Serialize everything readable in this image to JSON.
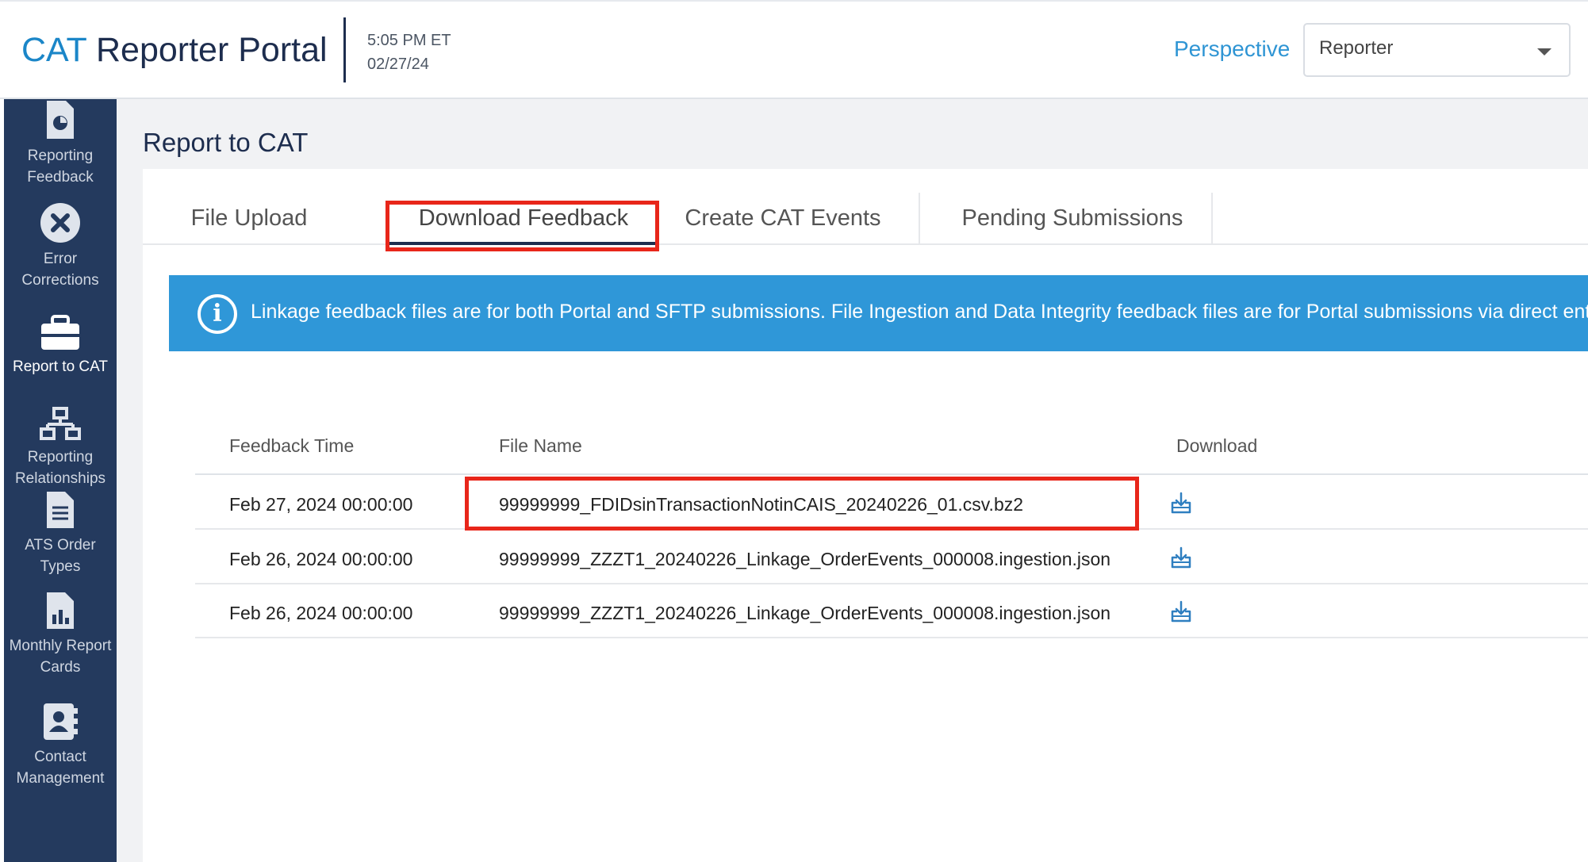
{
  "header": {
    "brand_prefix": "CAT",
    "brand_suffix": " Reporter Portal",
    "time": "5:05 PM ET",
    "date": "02/27/24",
    "perspective_label": "Perspective",
    "perspective_value": "Reporter"
  },
  "sidebar": {
    "items": [
      {
        "label": "Reporting Feedback",
        "icon": "report-feedback-icon"
      },
      {
        "label": "Error Corrections",
        "icon": "error-x-icon"
      },
      {
        "label": "Report to CAT",
        "icon": "briefcase-icon",
        "active": true
      },
      {
        "label": "Reporting Relationships",
        "icon": "org-chart-icon"
      },
      {
        "label": "ATS Order Types",
        "icon": "document-icon"
      },
      {
        "label": "Monthly Report Cards",
        "icon": "chart-document-icon"
      },
      {
        "label": "Contact Management",
        "icon": "contact-book-icon"
      }
    ]
  },
  "main": {
    "title": "Report to CAT",
    "tabs": [
      {
        "label": "File Upload"
      },
      {
        "label": "Download Feedback",
        "active": true
      },
      {
        "label": "Create CAT Events"
      },
      {
        "label": "Pending Submissions"
      }
    ],
    "banner_text": "Linkage feedback files are for both Portal and SFTP submissions. File Ingestion and Data Integrity feedback files are for Portal submissions via direct entry/",
    "table": {
      "columns": [
        "Feedback Time",
        "File Name",
        "Download"
      ],
      "rows": [
        {
          "time": "Feb 27, 2024 00:00:00",
          "file": "99999999_FDIDsinTransactionNotinCAIS_20240226_01.csv.bz2"
        },
        {
          "time": "Feb 26, 2024 00:00:00",
          "file": "99999999_ZZZT1_20240226_Linkage_OrderEvents_000008.ingestion.json"
        },
        {
          "time": "Feb 26, 2024 00:00:00",
          "file": "99999999_ZZZT1_20240226_Linkage_OrderEvents_000008.ingestion.json"
        }
      ]
    }
  },
  "colors": {
    "brand_blue": "#1b86c8",
    "navy": "#1d2d4e",
    "sidebar_bg": "#243a5e",
    "banner_bg": "#2f97d8",
    "highlight_red": "#e8261a"
  }
}
